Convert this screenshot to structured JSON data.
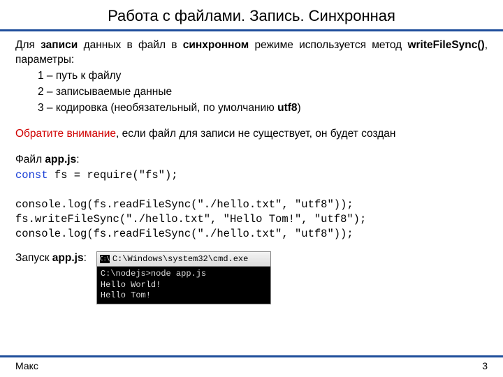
{
  "title": "Работа с файлами. Запись. Синхронная",
  "intro": {
    "pre": "Для ",
    "b1": "записи",
    "mid1": " данных в файл в ",
    "b2": "синхронном",
    "mid2": " режиме используется метод ",
    "b3": "writeFileSync()",
    "post": ", параметры:"
  },
  "params": {
    "p1": "1 – путь к файлу",
    "p2": "2 – записываемые данные",
    "p3pre": "3 – кодировка (необязательный, по умолчанию ",
    "p3b": "utf8",
    "p3post": ")"
  },
  "warn": {
    "label": "Обратите внимание",
    "text": ", если файл для записи не существует, он будет создан"
  },
  "filelabel": {
    "pre": "Файл ",
    "b": "app.js",
    "post": ":"
  },
  "code": {
    "kw": "const",
    "line1rest": " fs = require(\"fs\");",
    "line2": "",
    "line3": "console.log(fs.readFileSync(\"./hello.txt\", \"utf8\"));",
    "line4": "fs.writeFileSync(\"./hello.txt\", \"Hello Tom!\", \"utf8\");",
    "line5": "console.log(fs.readFileSync(\"./hello.txt\", \"utf8\"));"
  },
  "run": {
    "pre": "Запуск ",
    "b": "app.js",
    "post": ":"
  },
  "console": {
    "icon": "C:\\",
    "title": "C:\\Windows\\system32\\cmd.exe",
    "body": "C:\\nodejs>node app.js\nHello World!\nHello Tom!"
  },
  "footer": {
    "author": "Макс",
    "page": "3"
  }
}
